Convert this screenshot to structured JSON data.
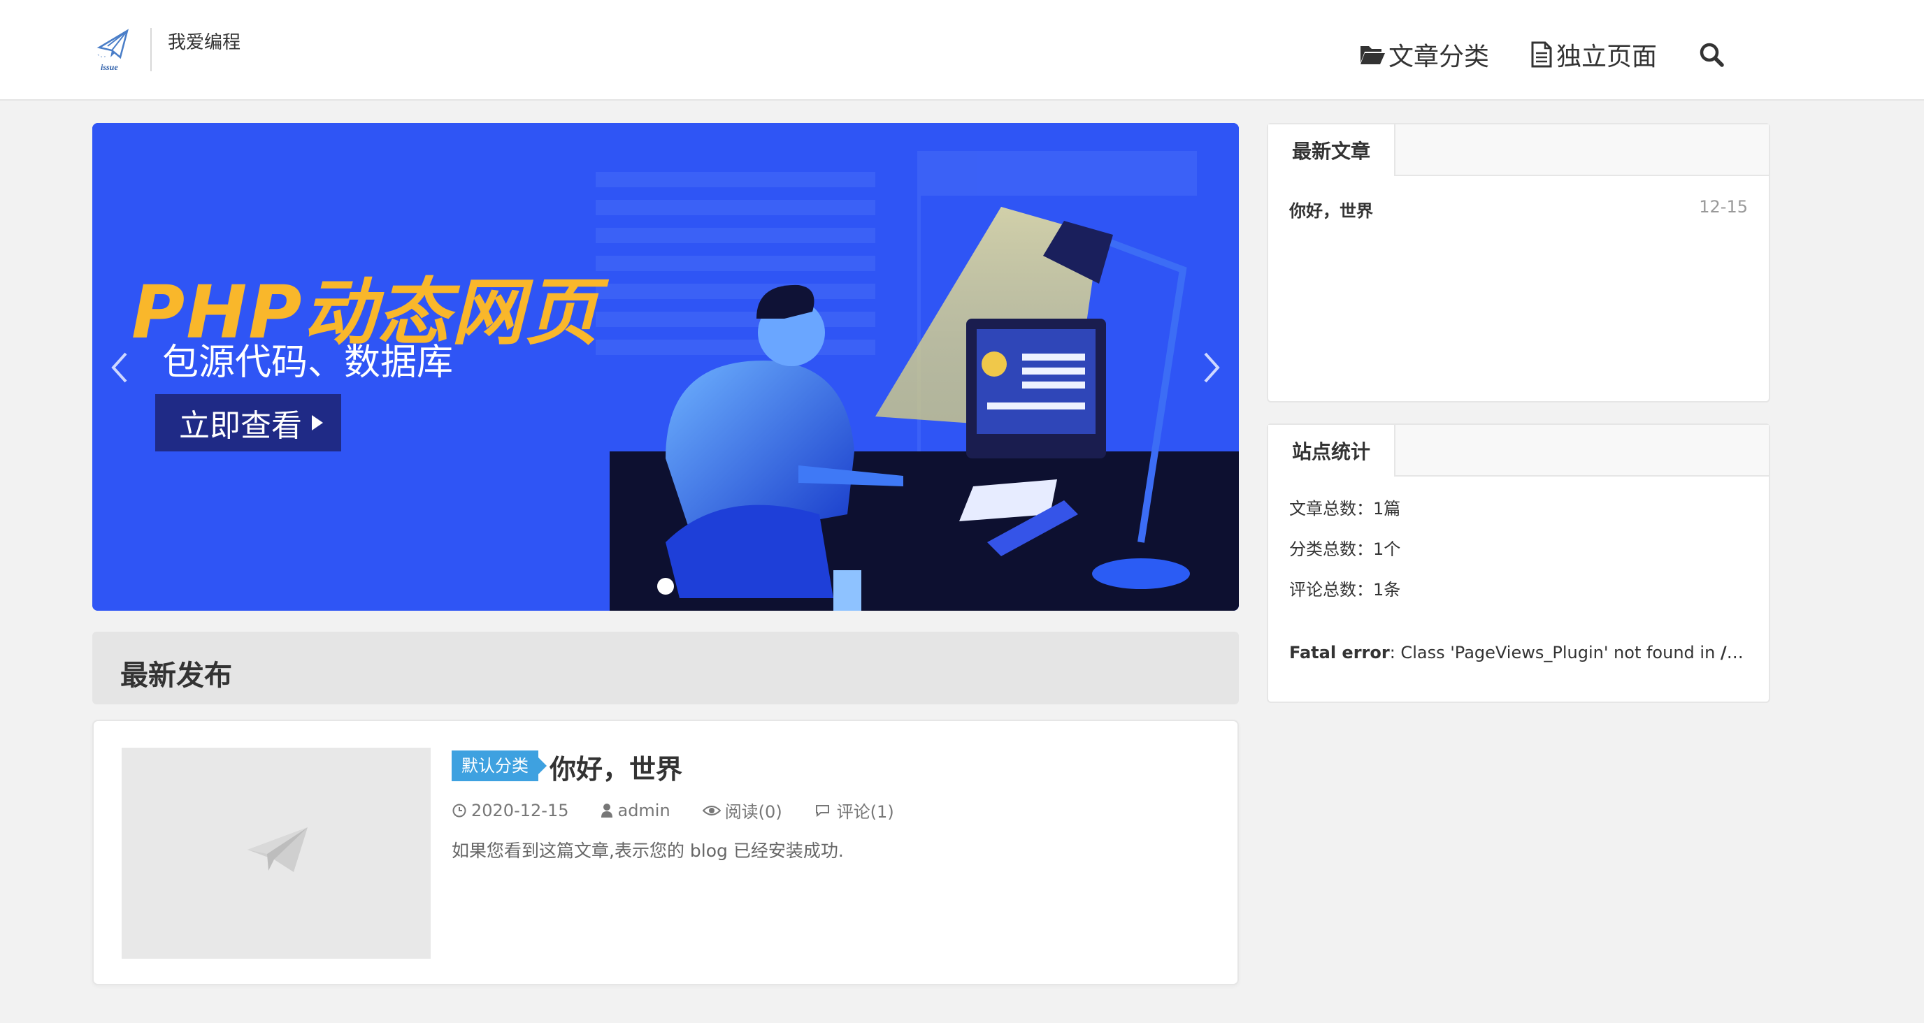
{
  "header": {
    "site_name": "我爱编程",
    "logo_text": "issue",
    "nav": [
      {
        "label": "文章分类",
        "icon": "folder-open-icon"
      },
      {
        "label": "独立页面",
        "icon": "file-icon"
      }
    ],
    "search_icon": "search-icon"
  },
  "banner": {
    "title": "PHP动态网页",
    "subtitle": "包源代码、数据库",
    "button_label": "立即查看",
    "prev_icon": "chevron-left-icon",
    "next_icon": "chevron-right-icon",
    "active_slide": 1,
    "slide_count": 1,
    "colors": {
      "background": "#2f55f5",
      "title": "#f9b72b",
      "button": "#1f2a86"
    }
  },
  "latest": {
    "heading": "最新发布",
    "posts": [
      {
        "category": "默认分类",
        "title": "你好，世界",
        "date": "2020-12-15",
        "author": "admin",
        "views": "阅读(0)",
        "comments": "评论(1)",
        "excerpt": "如果您看到这篇文章,表示您的 blog 已经安装成功."
      }
    ]
  },
  "sidebar": {
    "recent": {
      "heading": "最新文章",
      "items": [
        {
          "title": "你好，世界",
          "date": "12-15"
        }
      ]
    },
    "stats": {
      "heading": "站点统计",
      "lines": [
        "文章总数：1篇",
        "分类总数：1个",
        "评论总数：1条"
      ],
      "fatal_label": "Fatal error",
      "fatal_message": ": Class 'PageViews_Plugin' not found in ",
      "fatal_path": "/www/..."
    }
  },
  "colors": {
    "accent": "#3ea1e0",
    "page_bg": "#f2f2f2"
  }
}
